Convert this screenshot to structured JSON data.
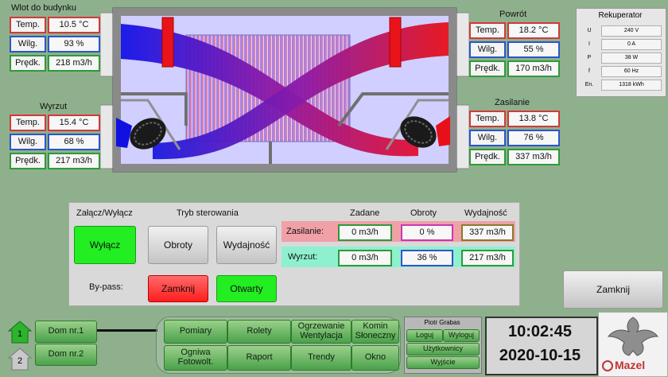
{
  "intake": {
    "title": "Wlot do budynku",
    "rows": [
      {
        "label": "Temp.",
        "value": "10.5 °C"
      },
      {
        "label": "Wilg.",
        "value": "93 %"
      },
      {
        "label": "Prędk.",
        "value": "218 m3/h"
      }
    ]
  },
  "exhaust": {
    "title": "Wyrzut",
    "rows": [
      {
        "label": "Temp.",
        "value": "15.4 °C"
      },
      {
        "label": "Wilg.",
        "value": "68 %"
      },
      {
        "label": "Prędk.",
        "value": "217 m3/h"
      }
    ]
  },
  "return_air": {
    "title": "Powrót",
    "rows": [
      {
        "label": "Temp.",
        "value": "18.2 °C"
      },
      {
        "label": "Wilg.",
        "value": "55 %"
      },
      {
        "label": "Prędk.",
        "value": "170 m3/h"
      }
    ]
  },
  "supply": {
    "title": "Zasilanie",
    "rows": [
      {
        "label": "Temp.",
        "value": "13.8 °C"
      },
      {
        "label": "Wilg.",
        "value": "76 %"
      },
      {
        "label": "Prędk.",
        "value": "337 m3/h"
      }
    ]
  },
  "recuperator": {
    "title": "Rekuperator",
    "rows": [
      {
        "key": "U",
        "value": "240 V"
      },
      {
        "key": "I",
        "value": "0 A"
      },
      {
        "key": "P",
        "value": "38 W"
      },
      {
        "key": "f",
        "value": "60 Hz"
      },
      {
        "key": "En.",
        "value": "1318 kWh"
      }
    ]
  },
  "control": {
    "onoff_label": "Załącz/Wyłącz",
    "mode_label": "Tryb sterowania",
    "off_button": "Wyłącz",
    "mode_rpm": "Obroty",
    "mode_capacity": "Wydajność",
    "bypass_label": "By-pass:",
    "bypass_close": "Zamknij",
    "bypass_open": "Otwarty",
    "col_set": "Zadane",
    "col_rpm": "Obroty",
    "col_capacity": "Wydajność",
    "supply_row": {
      "label": "Zasilanie:",
      "set": "0 m3/h",
      "rpm": "0 %",
      "capacity": "337 m3/h"
    },
    "exhaust_row": {
      "label": "Wyrzut:",
      "set": "0 m3/h",
      "rpm": "36 %",
      "capacity": "217 m3/h"
    }
  },
  "close_button": "Zamknij",
  "houses": [
    {
      "num": "1",
      "label": "Dom nr.1"
    },
    {
      "num": "2",
      "label": "Dom nr.2"
    }
  ],
  "nav": {
    "pomiary": "Pomiary",
    "rolety": "Rolety",
    "ogrzewanie": "Ogrzewanie\nWentylacja",
    "komin": "Komin\nSłoneczny",
    "ogniwa": "Ogniwa\nFotowolt.",
    "raport": "Raport",
    "trendy": "Trendy",
    "okno": "Okno"
  },
  "user": {
    "name": "Piotr Grabas",
    "login": "Loguj",
    "logout": "Wyloguj",
    "users": "Użytkownicy",
    "exit": "Wyjście"
  },
  "clock": {
    "time": "10:02:45",
    "date": "2020-10-15"
  },
  "logo": {
    "text": "Mazel"
  },
  "colors": {
    "supply_pink": "#f0a0a8",
    "exhaust_teal": "#8ff0cf",
    "green_btn": "#22ee22",
    "red_btn": "#ff2b2b"
  }
}
